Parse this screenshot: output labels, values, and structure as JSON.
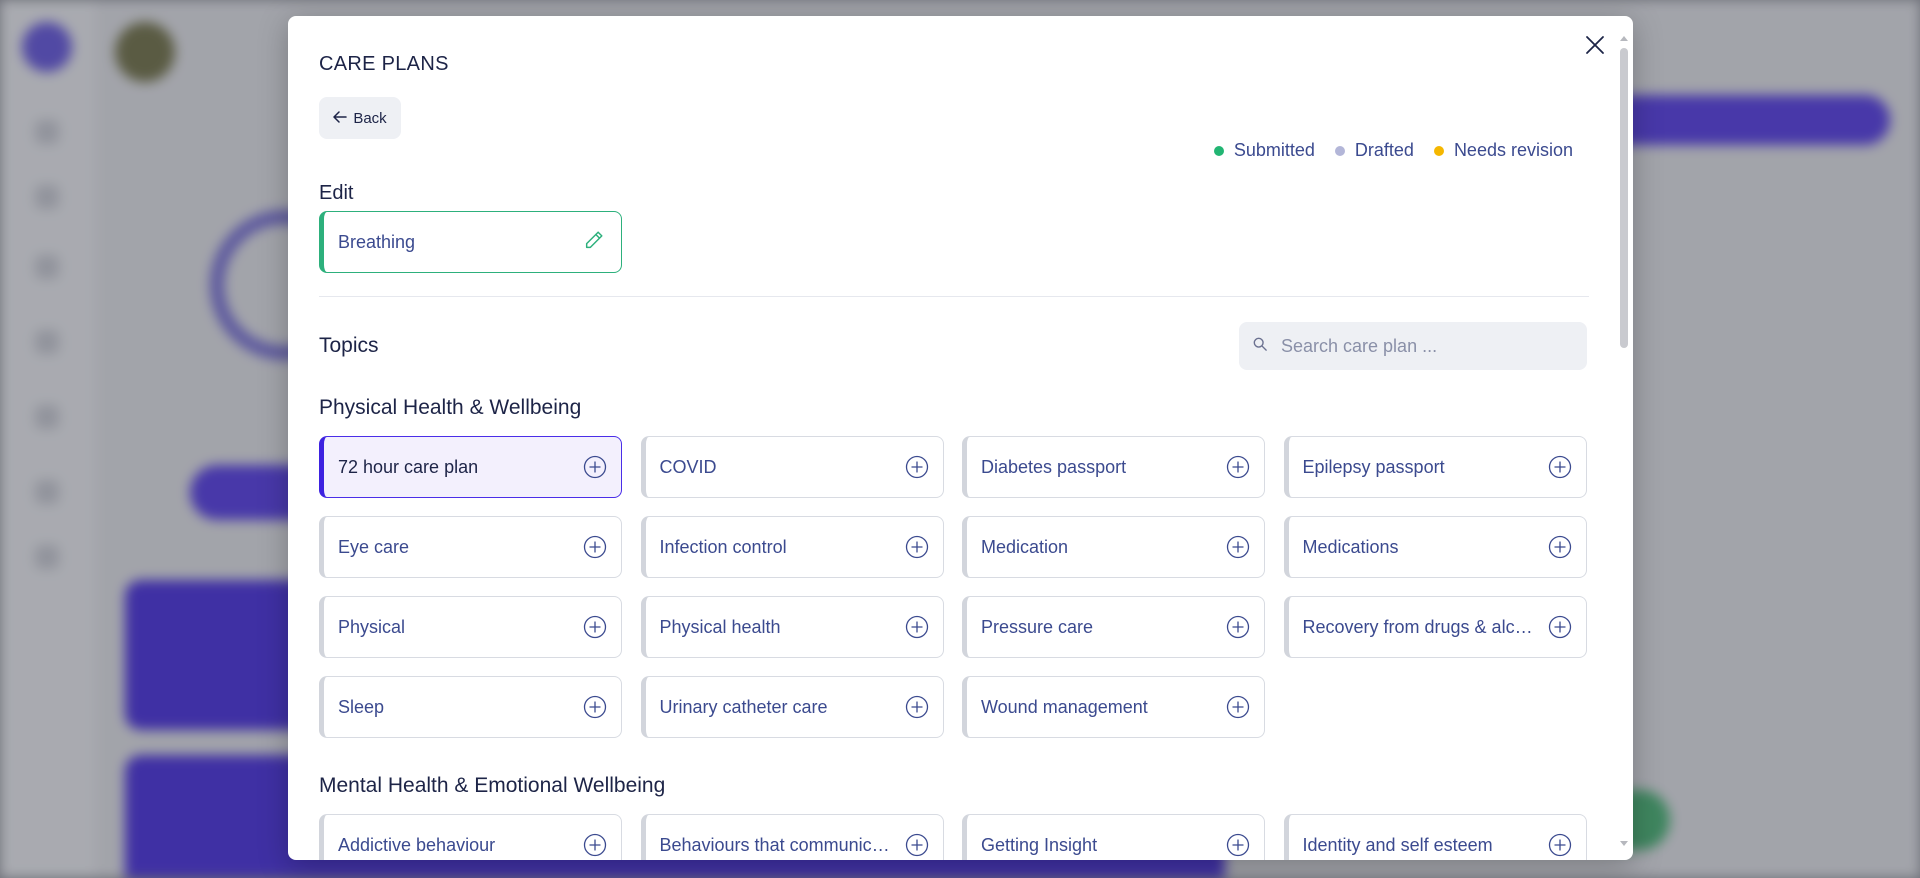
{
  "modal": {
    "title": "CARE PLANS",
    "back_label": "Back"
  },
  "legend": [
    {
      "label": "Submitted",
      "color": "#22b573"
    },
    {
      "label": "Drafted",
      "color": "#b3b6d8"
    },
    {
      "label": "Needs revision",
      "color": "#f5b700"
    }
  ],
  "edit": {
    "label": "Edit",
    "current_plan": "Breathing"
  },
  "topics": {
    "label": "Topics",
    "search_placeholder": "Search care plan ..."
  },
  "sections": [
    {
      "title": "Physical Health & Wellbeing",
      "items": [
        "72 hour care plan",
        "COVID",
        "Diabetes passport",
        "Epilepsy passport",
        "Eye care",
        "Infection control",
        "Medication",
        "Medications",
        "Physical",
        "Physical health",
        "Pressure care",
        "Recovery from drugs & alcohol",
        "Sleep",
        "Urinary catheter care",
        "Wound management"
      ]
    },
    {
      "title": "Mental Health & Emotional Wellbeing",
      "items": [
        "Addictive behaviour",
        "Behaviours that communicate distress",
        "Getting Insight",
        "Identity and self esteem"
      ]
    }
  ],
  "colors": {
    "accent": "#4a2ee8",
    "edit_border": "#2db07c",
    "text_primary": "#1d2447",
    "text_link": "#3b4a8f"
  },
  "icons": {
    "close": "close-icon",
    "back": "arrow-left-icon",
    "edit": "pencil-icon",
    "search": "search-icon",
    "add": "plus-circle-icon"
  }
}
